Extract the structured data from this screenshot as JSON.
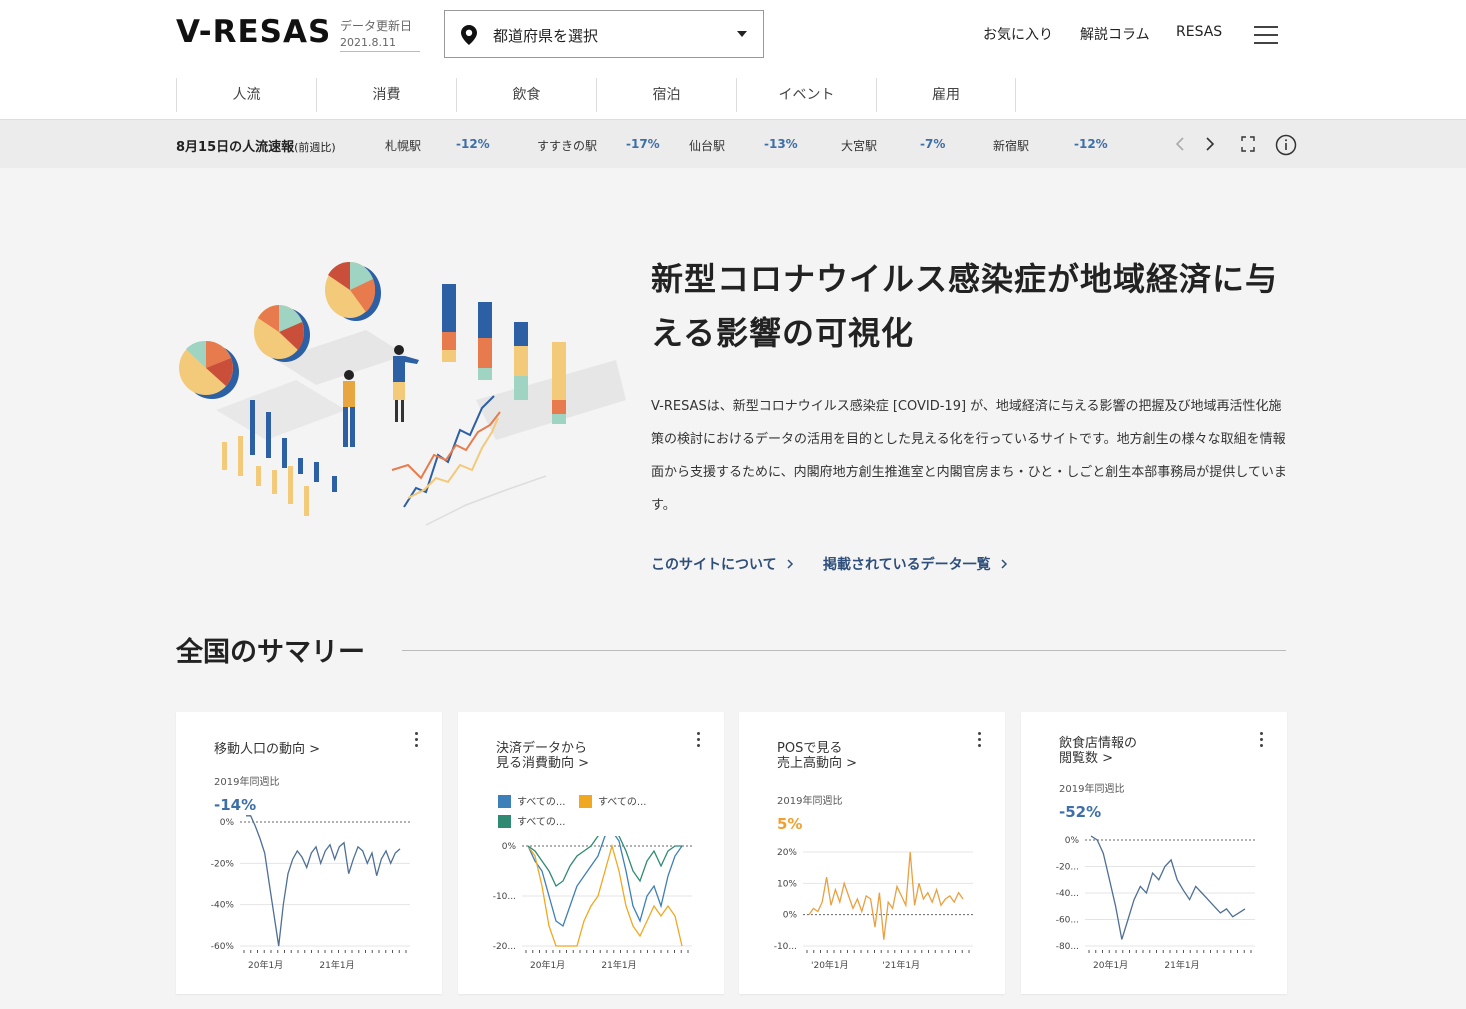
{
  "header": {
    "logo": "V-RESAS",
    "update_label": "データ更新日",
    "update_date": "2021.8.11",
    "pref_select": "都道府県を選択",
    "links": [
      "お気に入り",
      "解説コラム",
      "RESAS"
    ]
  },
  "tabs": [
    "人流",
    "消費",
    "飲食",
    "宿泊",
    "イベント",
    "雇用"
  ],
  "ticker": {
    "title": "8月15日の人流速報",
    "title_note": "(前週比)",
    "items": [
      {
        "station": "札幌駅",
        "value": "-12%"
      },
      {
        "station": "すすきの駅",
        "value": "-17%"
      },
      {
        "station": "仙台駅",
        "value": "-13%"
      },
      {
        "station": "大宮駅",
        "value": "-7%"
      },
      {
        "station": "新宿駅",
        "value": "-12%"
      }
    ]
  },
  "hero": {
    "title": "新型コロナウイルス感染症が地域経済に与える影響の可視化",
    "description": "V-RESASは、新型コロナウイルス感染症 [COVID-19] が、地域経済に与える影響の把握及び地域再活性化施策の検討におけるデータの活用を目的とした見える化を行っているサイトです。地方創生の様々な取組を情報面から支援するために、内閣府地方創生推進室と内閣官房まち・ひと・しごと創生本部事務局が提供しています。",
    "link_about": "このサイトについて",
    "link_data": "掲載されているデータ一覧"
  },
  "summary": {
    "title": "全国のサマリー",
    "cards": [
      {
        "title": "移動人口の動向 >",
        "sub": "2019年同週比",
        "value": "-14%",
        "value_color": "#3d6fa8",
        "chart_data": {
          "type": "line",
          "yticks": [
            "0%",
            "-20%",
            "-40%",
            "-60%"
          ],
          "xticks": [
            "20年1月",
            "21年1月"
          ],
          "series": [
            {
              "color": "#4e6f96",
              "values": [
                5,
                5,
                -2,
                -8,
                -15,
                -30,
                -45,
                -60,
                -40,
                -25,
                -18,
                -14,
                -17,
                -22,
                -15,
                -12,
                -20,
                -14,
                -11,
                -18,
                -12,
                -10,
                -25,
                -18,
                -12,
                -14,
                -20,
                -15,
                -26,
                -18,
                -14,
                -20,
                -15,
                -13
              ]
            }
          ]
        }
      },
      {
        "title": "決済データから\n見る消費動向 >",
        "legend": [
          "すべての...",
          "すべての...",
          "すべての..."
        ],
        "legend_colors": [
          "#3d7fb8",
          "#f0a820",
          "#2e8a70"
        ],
        "chart_data": {
          "type": "line",
          "yticks": [
            "0%",
            "-10...",
            "-20..."
          ],
          "xticks": [
            "20年1月",
            "21年1月"
          ],
          "series": [
            {
              "color": "#3d7fb8",
              "values": [
                0,
                -3,
                -5,
                -10,
                -15,
                -16,
                -12,
                -8,
                -6,
                -4,
                -2,
                2,
                6,
                1,
                -5,
                -12,
                -15,
                -10,
                -8,
                -12,
                -6,
                -2,
                0
              ]
            },
            {
              "color": "#f0a820",
              "values": [
                0,
                -2,
                -8,
                -16,
                -25,
                -27,
                -24,
                -20,
                -15,
                -12,
                -10,
                -5,
                0,
                -5,
                -12,
                -16,
                -18,
                -15,
                -12,
                -14,
                -12,
                -14,
                -20
              ]
            },
            {
              "color": "#2e8a70",
              "values": [
                0,
                -1,
                -3,
                -5,
                -8,
                -7,
                -4,
                -2,
                -1,
                0,
                2,
                4,
                5,
                2,
                -1,
                -5,
                -7,
                -3,
                -1,
                -4,
                -1,
                0,
                0
              ]
            }
          ]
        }
      },
      {
        "title": "POSで見る\n売上高動向 >",
        "sub": "2019年同週比",
        "value": "5%",
        "value_color": "#f0a030",
        "chart_data": {
          "type": "line",
          "yticks": [
            "20%",
            "10%",
            "0%",
            "-10..."
          ],
          "xticks": [
            "'20年1月",
            "'21年1月"
          ],
          "series": [
            {
              "color": "#e9a040",
              "values": [
                0,
                2,
                1,
                4,
                12,
                3,
                8,
                4,
                10,
                6,
                2,
                5,
                1,
                6,
                5,
                -4,
                7,
                -8,
                4,
                2,
                9,
                6,
                3,
                20,
                3,
                10,
                5,
                7,
                4,
                8,
                3,
                5,
                6,
                4,
                7,
                5
              ]
            }
          ]
        }
      },
      {
        "title": "飲食店情報の\n閲覧数 >",
        "sub": "2019年同週比",
        "value": "-52%",
        "value_color": "#3d6fa8",
        "chart_data": {
          "type": "line",
          "yticks": [
            "0%",
            "-20...",
            "-40...",
            "-60...",
            "-80..."
          ],
          "xticks": [
            "20年1月",
            "21年1月"
          ],
          "series": [
            {
              "color": "#4e6f96",
              "values": [
                5,
                0,
                -10,
                -30,
                -50,
                -75,
                -60,
                -45,
                -35,
                -40,
                -25,
                -30,
                -20,
                -15,
                -30,
                -38,
                -45,
                -35,
                -40,
                -45,
                -50,
                -55,
                -52,
                -58,
                -55,
                -52
              ]
            }
          ]
        }
      }
    ]
  }
}
